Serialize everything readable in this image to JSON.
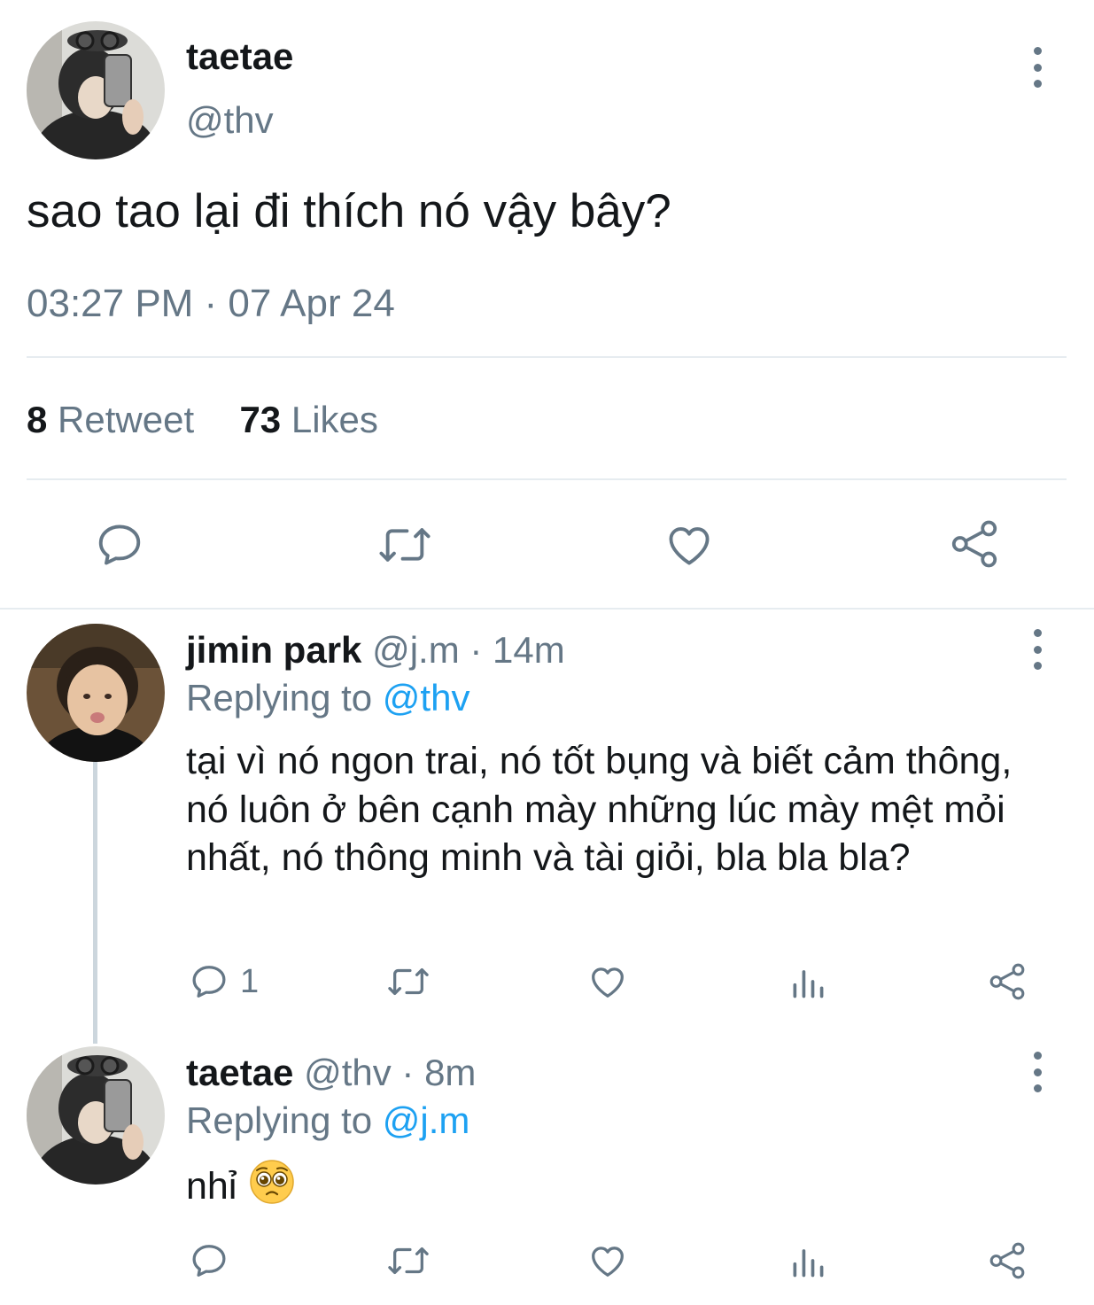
{
  "main_tweet": {
    "display_name": "taetae",
    "handle": "@thv",
    "text": "sao tao lại đi thích nó vậy bây?",
    "timestamp": "03:27 PM · 07 Apr 24",
    "retweet_count": "8",
    "retweet_label": "Retweet",
    "like_count": "73",
    "like_label": "Likes",
    "icons": [
      "reply-icon",
      "retweet-icon",
      "like-icon",
      "share-icon"
    ]
  },
  "replies": [
    {
      "display_name": "jimin park",
      "handle": "@j.m",
      "time": "· 14m",
      "replying_prefix": "Replying to",
      "replying_to": "@thv",
      "text": "tại vì nó ngon trai, nó tốt bụng và biết cảm thông, nó luôn ở bên cạnh mày những lúc mày mệt mỏi nhất, nó thông minh và tài giỏi, bla bla bla?",
      "reply_count": "1",
      "icons": [
        "reply-icon",
        "retweet-icon",
        "like-icon",
        "views-icon",
        "share-icon"
      ]
    },
    {
      "display_name": "taetae",
      "handle": "@thv",
      "time": "· 8m",
      "replying_prefix": "Replying to",
      "replying_to": "@j.m",
      "text": "nhỉ",
      "emoji": "pleading-face-emoji",
      "icons": [
        "reply-icon",
        "retweet-icon",
        "like-icon",
        "views-icon",
        "share-icon"
      ]
    }
  ],
  "colors": {
    "text": "#14171a",
    "muted": "#657786",
    "link": "#1da1f2",
    "divider": "#e6ecf0"
  }
}
